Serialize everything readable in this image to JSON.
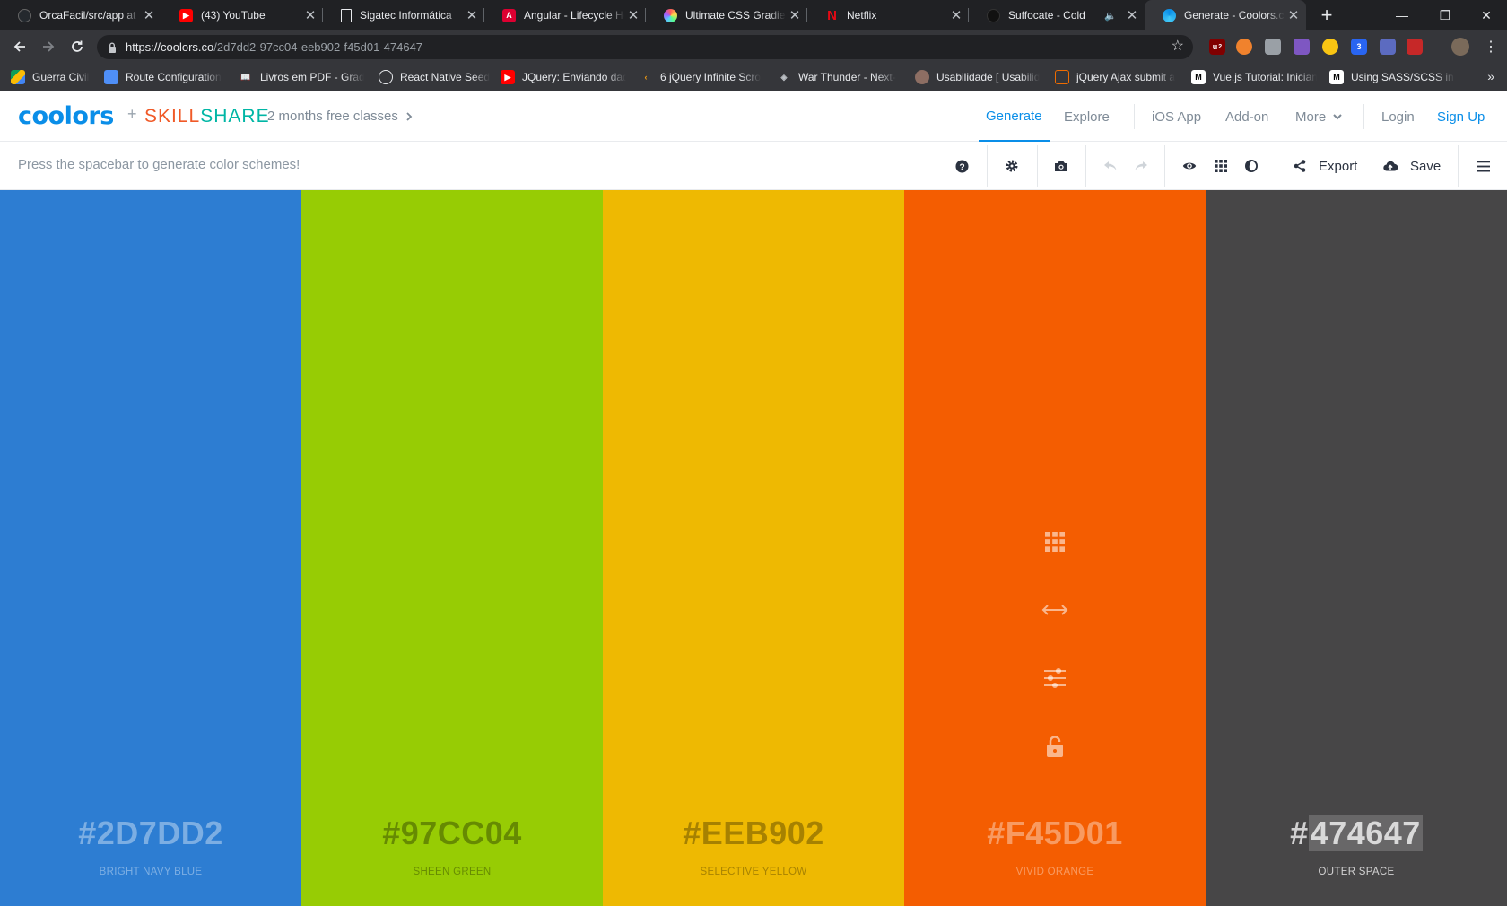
{
  "browser": {
    "tabs": [
      {
        "title": "OrcaFacil/src/app at m",
        "icon": "github-icon",
        "color": "#24292e"
      },
      {
        "title": "(43) YouTube",
        "icon": "youtube-icon",
        "color": "#ff0000"
      },
      {
        "title": "Sigatec Informática",
        "icon": "document-icon",
        "color": "#e8eaed"
      },
      {
        "title": "Angular - Lifecycle Ho",
        "icon": "angular-icon",
        "color": "#dd0031"
      },
      {
        "title": "Ultimate CSS Gradient",
        "icon": "gradient-icon",
        "color": "#7fd4ff"
      },
      {
        "title": "Netflix",
        "icon": "netflix-icon",
        "color": "#e50914"
      },
      {
        "title": "Suffocate - Cold",
        "icon": "music-icon",
        "color": "#111111"
      },
      {
        "title": "Generate - Coolors.co",
        "icon": "coolors-icon",
        "color": "#0a8ee8"
      }
    ],
    "url_domain": "https://coolors.co",
    "url_path": "/2d7dd2-97cc04-eeb902-f45d01-474647",
    "bookmarks": [
      {
        "label": "Guerra Civil",
        "icon": "google-drive-icon",
        "color": "#fbbc04"
      },
      {
        "label": "Route Configuration",
        "icon": "page-icon",
        "color": "#4f8ff7"
      },
      {
        "label": "Livros em PDF - Grad",
        "icon": "book-icon",
        "color": "#6a7bd6"
      },
      {
        "label": "React Native Seed",
        "icon": "react-icon",
        "color": "#61dafb"
      },
      {
        "label": "JQuery: Enviando dad",
        "icon": "youtube-icon",
        "color": "#ff0000"
      },
      {
        "label": "6 jQuery Infinite Scro",
        "icon": "code-icon",
        "color": "#f39c12"
      },
      {
        "label": "War Thunder - Next-",
        "icon": "war-thunder-icon",
        "color": "#bdc1c6"
      },
      {
        "label": "Usabilidade [ Usabilid",
        "icon": "mascot-icon",
        "color": "#d9d9d9"
      },
      {
        "label": "jQuery Ajax submit a",
        "icon": "stack-icon",
        "color": "#ef6c00"
      },
      {
        "label": "Vue.js Tutorial: Inician",
        "icon": "medium-icon",
        "color": "#ffffff"
      },
      {
        "label": "Using SASS/SCSS in V",
        "icon": "medium-icon",
        "color": "#ffffff"
      }
    ],
    "ext_badge": "2"
  },
  "site": {
    "logo": "coolors",
    "plus": "+",
    "skillshare_a": "SKILL",
    "skillshare_b": "SHARE",
    "promo": "2 months free classes",
    "nav": {
      "generate": "Generate",
      "explore": "Explore",
      "ios": "iOS App",
      "addon": "Add-on",
      "more": "More",
      "login": "Login",
      "signup": "Sign Up"
    },
    "hint": "Press the spacebar to generate color schemes!",
    "export_label": "Export",
    "save_label": "Save"
  },
  "palette": [
    {
      "hex_prefix": "",
      "hex_body": "#2D7DD2",
      "name": "BRIGHT NAVY BLUE",
      "color": "#2d7dd2",
      "text_color": "rgba(255,255,255,0.38)"
    },
    {
      "hex_prefix": "",
      "hex_body": "#97CC04",
      "name": "SHEEN GREEN",
      "color": "#97cc04",
      "text_color": "rgba(0,0,0,0.32)"
    },
    {
      "hex_prefix": "",
      "hex_body": "#EEB902",
      "name": "SELECTIVE YELLOW",
      "color": "#eeb902",
      "text_color": "rgba(0,0,0,0.30)"
    },
    {
      "hex_prefix": "",
      "hex_body": "#F45D01",
      "name": "VIVID ORANGE",
      "color": "#f45d01",
      "text_color": "rgba(255,255,255,0.38)"
    },
    {
      "hex_prefix": "#",
      "hex_body": "474647",
      "name": "OUTER SPACE",
      "color": "#474647",
      "text_color": "rgba(255,255,255,0.75)"
    }
  ]
}
